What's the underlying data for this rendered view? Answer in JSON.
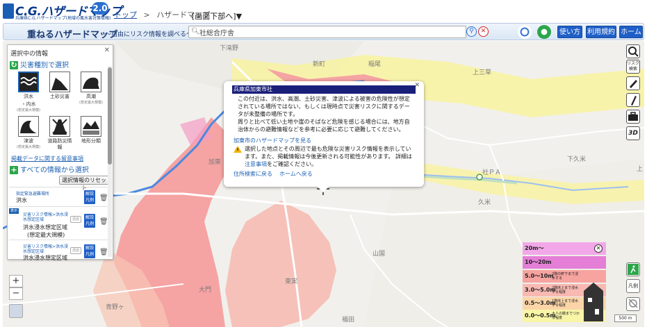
{
  "logo": {
    "name": "ハザードマップ",
    "prefix": "C.G.",
    "version": "2.0",
    "sub": "兵庫県C.G.ハザードマップ(地域の風水害対策情報)"
  },
  "breadcrumb": {
    "top": "トップ",
    "sep": ">",
    "current": "ハザードマップ"
  },
  "screen_jump": "[画面下部へ]▼",
  "header": {
    "title": "重ねるハザードマップ",
    "subtitle": "〜自由にリスク情報を調べる〜",
    "search_value": "社総合庁舎",
    "buttons": {
      "usage": "使い方",
      "terms": "利用規約",
      "home": "ホーム"
    }
  },
  "side_panel": {
    "title": "選択中の情報",
    "by_type": "災害種別で選択",
    "hazards": [
      {
        "label": "洪水",
        "sub": "・内水",
        "note": "(想定最大規模)"
      },
      {
        "label": "土砂災害",
        "sub": "",
        "note": ""
      },
      {
        "label": "高潮",
        "sub": "",
        "note": "(想定最大規模)"
      },
      {
        "label": "津波",
        "sub": "",
        "note": "(想定最大規模)"
      },
      {
        "label": "道路防災情報",
        "sub": "",
        "note": ""
      },
      {
        "label": "地形分類",
        "sub": "",
        "note": ""
      }
    ],
    "notes_link": "掲載データに関する留意事項",
    "all_info": "すべての情報から選択",
    "reset": "選択情報のリセット",
    "layers": [
      {
        "small": "指定緊急避難場所",
        "name": "洪水"
      },
      {
        "tag": "表示",
        "small": "災害リスク情報>洪水浸水想定区域",
        "name": "洪水浸水想定区域",
        "name2": "(想定最大規模)"
      },
      {
        "small": "災害リスク情報>洪水浸水想定区域",
        "name": "洪水浸水想定区域"
      }
    ],
    "legend_label": "解説\n凡例",
    "toggle_label": "透過"
  },
  "popup": {
    "title": "兵庫県加東市社",
    "body": "この付近は、洪水、高潮、土砂災害、津波による被害の危険性が想定されている場所ではない、もしくは現時点で災害リスクに関するデータが未整備の場所です。\n周りと比べて低い土地や崖のそばなど危険を感じる場合には、地方自治体からの避難情報などを参考に必要に応じて避難してください。",
    "city_link": "加東市のハザードマップを見る",
    "warning": "選択した地点とその周辺で最も危険な災害リスク情報を表示しています。また、掲載情報は今後更新される可能性があります。 詳細は",
    "warning_link": "注意事項",
    "warning_tail": "をご確認ください。",
    "back_search": "住所検索に戻る",
    "back_home": "ホームへ戻る"
  },
  "tools": {
    "risk": "リスク\n検索"
  },
  "map_labels": [
    {
      "text": "下滝野"
    },
    {
      "text": "新町"
    },
    {
      "text": "稲尾"
    },
    {
      "text": "上三草"
    },
    {
      "text": "下久米"
    },
    {
      "text": "社ＰＡ"
    },
    {
      "text": "久米"
    },
    {
      "text": "山国"
    },
    {
      "text": "東実"
    },
    {
      "text": "大門"
    },
    {
      "text": "青野ヶ"
    },
    {
      "text": "福田"
    },
    {
      "text": "加東"
    },
    {
      "text": "上"
    }
  ],
  "legend": {
    "rows": [
      {
        "depth": "20m〜",
        "desc": "",
        "color": "#f2a8e8"
      },
      {
        "depth": "10〜20m",
        "desc": "",
        "color": "#e47ed6"
      },
      {
        "depth": "5.0〜10m",
        "desc": "2階の軒下まで浸水する",
        "color": "#f7a3a0"
      },
      {
        "depth": "3.0〜5.0m",
        "desc": "2階床上まで浸水する程度",
        "color": "#f8b9b2"
      },
      {
        "depth": "0.5〜3.0m",
        "desc": "1階床上まで浸水する程度",
        "color": "#fbd5a8"
      },
      {
        "depth": "0.0〜0.5m",
        "desc": "大人の膝までつかる程度",
        "color": "#f8f5a7"
      }
    ]
  },
  "scale": "500 m",
  "colors": {
    "brand": "#1f5fc7",
    "flood": "#f5a3a3",
    "flood_deep": "#f08c8c",
    "river": "#4b88e0"
  }
}
